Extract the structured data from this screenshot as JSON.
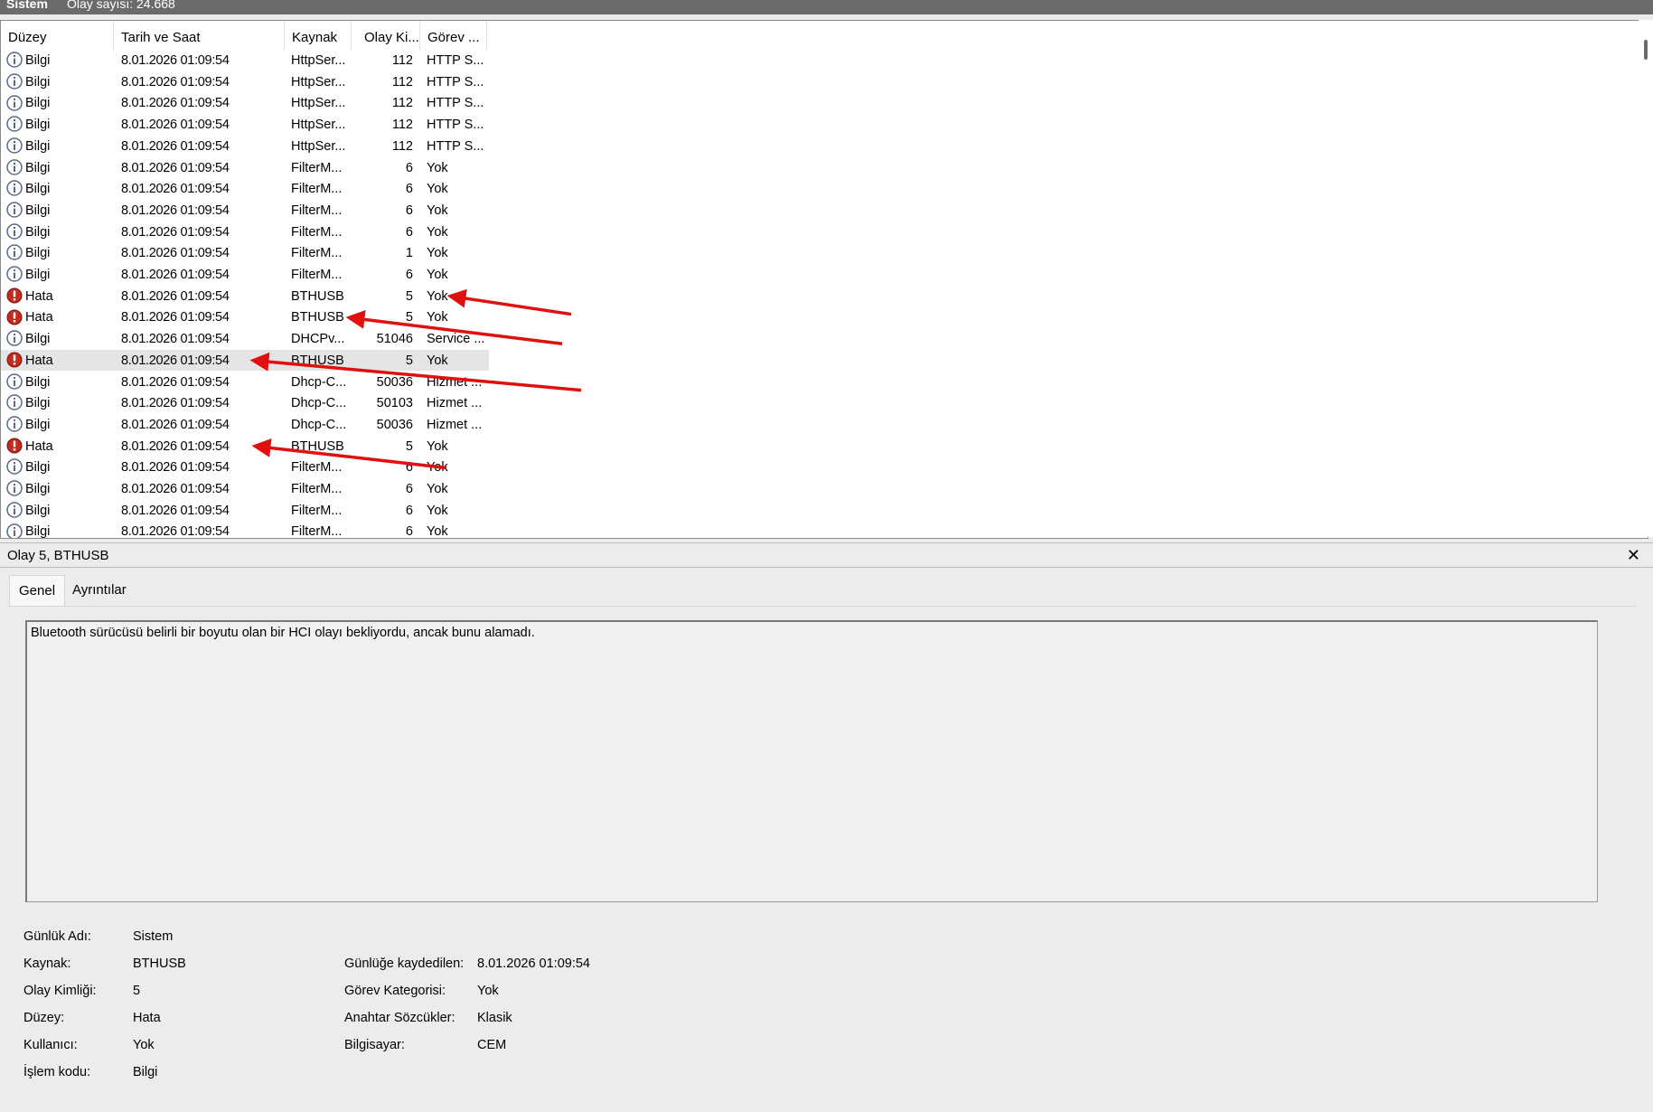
{
  "topbar": {
    "log_name": "Sistem",
    "event_count": "Olay sayısı: 24.668"
  },
  "columns": [
    "Düzey",
    "Tarih ve Saat",
    "Kaynak",
    "Olay Ki...",
    "Görev ..."
  ],
  "rows": [
    {
      "level": "Bilgi",
      "date": "8.01.2026 01:09:54",
      "source": "HttpSer...",
      "id": "112",
      "task": "HTTP S..."
    },
    {
      "level": "Bilgi",
      "date": "8.01.2026 01:09:54",
      "source": "HttpSer...",
      "id": "112",
      "task": "HTTP S..."
    },
    {
      "level": "Bilgi",
      "date": "8.01.2026 01:09:54",
      "source": "HttpSer...",
      "id": "112",
      "task": "HTTP S..."
    },
    {
      "level": "Bilgi",
      "date": "8.01.2026 01:09:54",
      "source": "HttpSer...",
      "id": "112",
      "task": "HTTP S..."
    },
    {
      "level": "Bilgi",
      "date": "8.01.2026 01:09:54",
      "source": "HttpSer...",
      "id": "112",
      "task": "HTTP S..."
    },
    {
      "level": "Bilgi",
      "date": "8.01.2026 01:09:54",
      "source": "FilterM...",
      "id": "6",
      "task": "Yok"
    },
    {
      "level": "Bilgi",
      "date": "8.01.2026 01:09:54",
      "source": "FilterM...",
      "id": "6",
      "task": "Yok"
    },
    {
      "level": "Bilgi",
      "date": "8.01.2026 01:09:54",
      "source": "FilterM...",
      "id": "6",
      "task": "Yok"
    },
    {
      "level": "Bilgi",
      "date": "8.01.2026 01:09:54",
      "source": "FilterM...",
      "id": "6",
      "task": "Yok"
    },
    {
      "level": "Bilgi",
      "date": "8.01.2026 01:09:54",
      "source": "FilterM...",
      "id": "1",
      "task": "Yok"
    },
    {
      "level": "Bilgi",
      "date": "8.01.2026 01:09:54",
      "source": "FilterM...",
      "id": "6",
      "task": "Yok"
    },
    {
      "level": "Hata",
      "date": "8.01.2026 01:09:54",
      "source": "BTHUSB",
      "id": "5",
      "task": "Yok"
    },
    {
      "level": "Hata",
      "date": "8.01.2026 01:09:54",
      "source": "BTHUSB",
      "id": "5",
      "task": "Yok"
    },
    {
      "level": "Bilgi",
      "date": "8.01.2026 01:09:54",
      "source": "DHCPv...",
      "id": "51046",
      "task": "Service ..."
    },
    {
      "level": "Hata",
      "date": "8.01.2026 01:09:54",
      "source": "BTHUSB",
      "id": "5",
      "task": "Yok",
      "selected": true
    },
    {
      "level": "Bilgi",
      "date": "8.01.2026 01:09:54",
      "source": "Dhcp-C...",
      "id": "50036",
      "task": "Hizmet ..."
    },
    {
      "level": "Bilgi",
      "date": "8.01.2026 01:09:54",
      "source": "Dhcp-C...",
      "id": "50103",
      "task": "Hizmet ..."
    },
    {
      "level": "Bilgi",
      "date": "8.01.2026 01:09:54",
      "source": "Dhcp-C...",
      "id": "50036",
      "task": "Hizmet ..."
    },
    {
      "level": "Hata",
      "date": "8.01.2026 01:09:54",
      "source": "BTHUSB",
      "id": "5",
      "task": "Yok"
    },
    {
      "level": "Bilgi",
      "date": "8.01.2026 01:09:54",
      "source": "FilterM...",
      "id": "6",
      "task": "Yok"
    },
    {
      "level": "Bilgi",
      "date": "8.01.2026 01:09:54",
      "source": "FilterM...",
      "id": "6",
      "task": "Yok"
    },
    {
      "level": "Bilgi",
      "date": "8.01.2026 01:09:54",
      "source": "FilterM...",
      "id": "6",
      "task": "Yok"
    },
    {
      "level": "Bilgi",
      "date": "8.01.2026 01:09:54",
      "source": "FilterM...",
      "id": "6",
      "task": "Yok"
    }
  ],
  "details": {
    "title": "Olay 5, BTHUSB",
    "close_icon": "✕",
    "tabs": [
      "Genel",
      "Ayrıntılar"
    ],
    "description": "Bluetooth sürücüsü belirli bir boyutu olan bir HCI olayı bekliyordu, ancak bunu alamadı.",
    "fields_left": [
      {
        "label": "Günlük Adı:",
        "value": "Sistem"
      },
      {
        "label": "Kaynak:",
        "value": "BTHUSB"
      },
      {
        "label": "Olay Kimliği:",
        "value": "5"
      },
      {
        "label": "Düzey:",
        "value": "Hata"
      },
      {
        "label": "Kullanıcı:",
        "value": "Yok"
      },
      {
        "label": "İşlem kodu:",
        "value": "Bilgi"
      }
    ],
    "fields_right": [
      {
        "label": "Günlüğe kaydedilen:",
        "value": "8.01.2026 01:09:54"
      },
      {
        "label": "Görev Kategorisi:",
        "value": "Yok"
      },
      {
        "label": "Anahtar Sözcükler:",
        "value": "Klasik"
      },
      {
        "label": "Bilgisayar:",
        "value": "CEM"
      }
    ]
  },
  "colors": {
    "error_icon": "#c42b1c",
    "info_icon": "#5a6a86",
    "arrow": "#e01010"
  }
}
